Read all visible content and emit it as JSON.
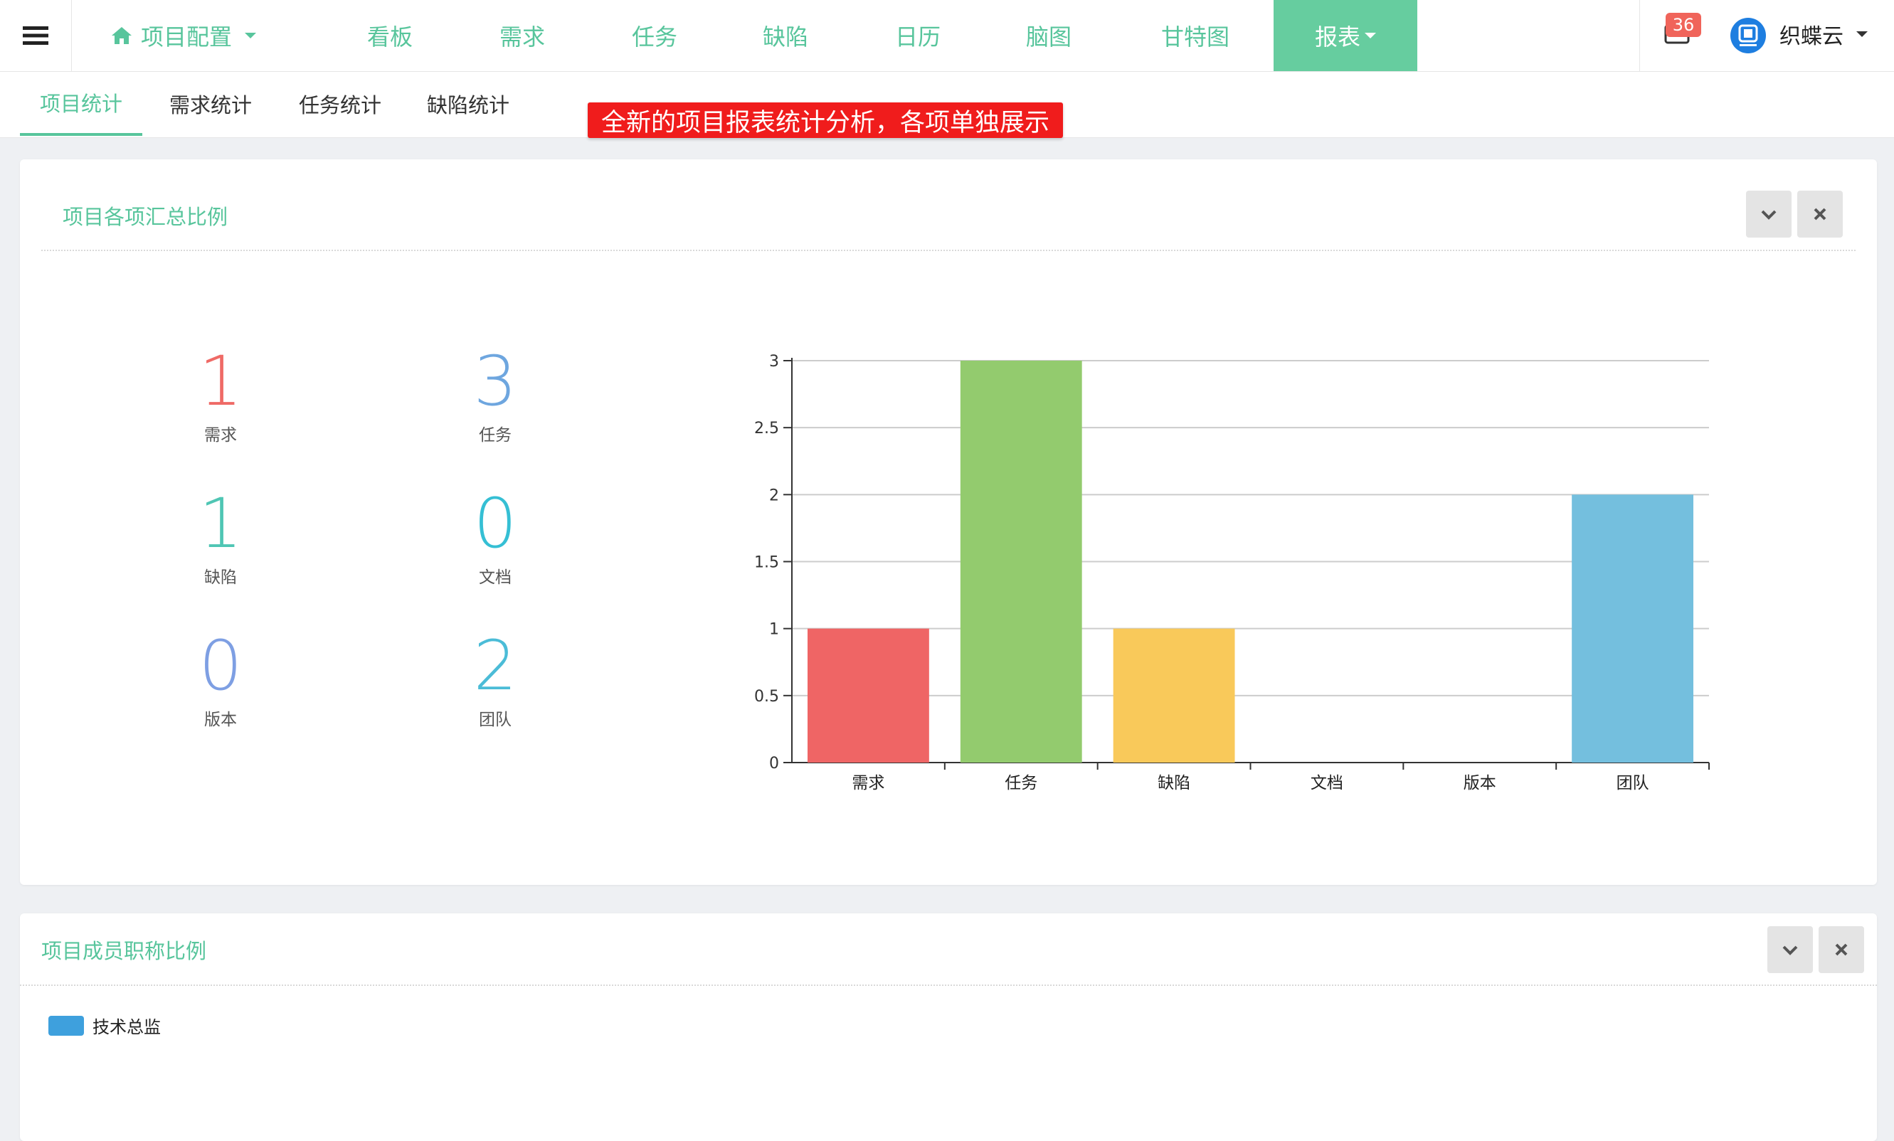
{
  "nav": {
    "project_config": "项目配置",
    "items": [
      "看板",
      "需求",
      "任务",
      "缺陷",
      "日历",
      "脑图",
      "甘特图"
    ],
    "report": "报表",
    "mail_badge": "36",
    "username": "织蝶云",
    "accent": "#58c59c",
    "active_bg": "#66cd9f"
  },
  "subtabs": [
    "项目统计",
    "需求统计",
    "任务统计",
    "缺陷统计"
  ],
  "promo": "全新的项目报表统计分析，各项单独展示",
  "panel1": {
    "title": "项目各项汇总比例",
    "stats": [
      {
        "value": "1",
        "label": "需求",
        "color": "#ef6a66"
      },
      {
        "value": "3",
        "label": "任务",
        "color": "#6ea6df"
      },
      {
        "value": "1",
        "label": "缺陷",
        "color": "#4fc6b4"
      },
      {
        "value": "0",
        "label": "文档",
        "color": "#35bfd4"
      },
      {
        "value": "0",
        "label": "版本",
        "color": "#7e9fe3"
      },
      {
        "value": "2",
        "label": "团队",
        "color": "#4bbcd7"
      }
    ]
  },
  "chart_data": {
    "type": "bar",
    "categories": [
      "需求",
      "任务",
      "缺陷",
      "文档",
      "版本",
      "团队"
    ],
    "values": [
      1,
      3,
      1,
      0,
      0,
      2
    ],
    "colors": [
      "#ef6565",
      "#93cb6e",
      "#f9c95a",
      "#999999",
      "#999999",
      "#74bfde"
    ],
    "yticks": [
      "0",
      "0.5",
      "1",
      "1.5",
      "2",
      "2.5",
      "3"
    ],
    "ylim": [
      0,
      3
    ],
    "grid": true
  },
  "panel2": {
    "title": "项目成员职称比例",
    "legend": [
      {
        "label": "技术总监",
        "color": "#3ea0dd"
      }
    ]
  }
}
